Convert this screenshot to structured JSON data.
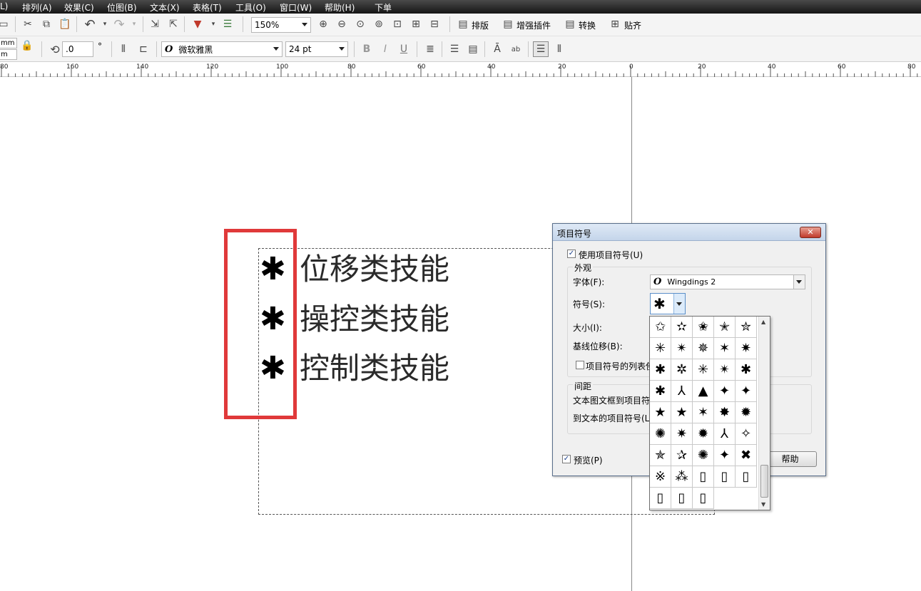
{
  "menubar": {
    "items": [
      "L)",
      "排列(A)",
      "效果(C)",
      "位图(B)",
      "文本(X)",
      "表格(T)",
      "工具(O)",
      "窗口(W)",
      "帮助(H)",
      "下单"
    ]
  },
  "toolbar1": {
    "zoom_value": "150%",
    "plugin_buttons": [
      "排版",
      "增强插件",
      "转换",
      "贴齐"
    ]
  },
  "toolbar2": {
    "unit_top": "mm",
    "unit_bottom": "m",
    "rotation_value": ".0",
    "degree_symbol": "°",
    "font_style_icon": "O",
    "font_name": "微软雅黑",
    "font_size": "24 pt"
  },
  "ruler": {
    "labels": [
      "80",
      "160",
      "140",
      "120",
      "100",
      "80",
      "60",
      "40",
      "20",
      "0",
      "20",
      "40",
      "60",
      "80"
    ]
  },
  "canvas": {
    "lines": [
      {
        "bullet": "✱",
        "text": "位移类技能"
      },
      {
        "bullet": "✱",
        "text": "操控类技能"
      },
      {
        "bullet": "✱",
        "text": "控制类技能"
      }
    ]
  },
  "dialog": {
    "title": "项目符号",
    "close_label": "✕",
    "use_bullets_label": "使用项目符号(U)",
    "use_bullets_checked": true,
    "appearance_group": "外观",
    "font_label": "字体(F):",
    "font_icon": "O",
    "font_value": "Wingdings 2",
    "symbol_label": "符号(S):",
    "symbol_value": "✱",
    "size_label": "大小(I):",
    "baseline_label": "基线位移(B):",
    "list_option_label": "项目符号的列表使",
    "spacing_group": "间距",
    "frame_to_bullet_label": "文本图文框到项目符",
    "bullet_to_text_label": "到文本的项目符号(L",
    "preview_label": "预览(P)",
    "preview_checked": true,
    "help_button": "帮助"
  },
  "symbol_grid": {
    "rows": [
      [
        "✩",
        "✫",
        "✬",
        "✭",
        "✮"
      ],
      [
        "✳",
        "✴",
        "✵",
        "✶",
        "✷"
      ],
      [
        "✱",
        "✲",
        "✳",
        "✴",
        "✱"
      ],
      [
        "✱",
        "⅄",
        "▲",
        "✦",
        "✦"
      ],
      [
        "★",
        "★",
        "✶",
        "✸",
        "✹"
      ],
      [
        "✺",
        "✷",
        "✹",
        "⅄",
        "✧"
      ],
      [
        "✯",
        "✰",
        "✺",
        "✦",
        "✖"
      ],
      [
        "※",
        "⁂",
        "▯",
        "▯",
        "▯"
      ],
      [
        "▯",
        "▯",
        "▯"
      ]
    ],
    "scroll_up": "▲",
    "scroll_down": "▼"
  }
}
